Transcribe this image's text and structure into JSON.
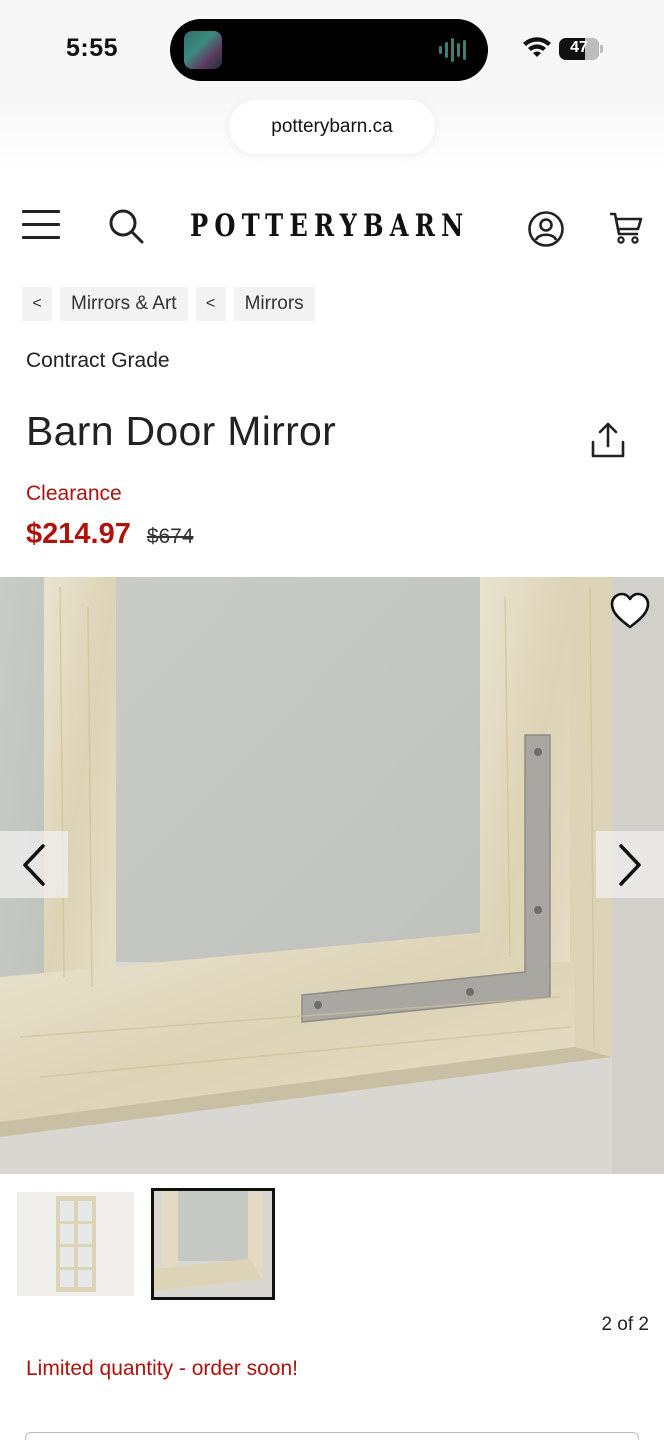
{
  "status_bar": {
    "time": "5:55",
    "battery": "47"
  },
  "browser": {
    "url": "potterybarn.ca"
  },
  "header": {
    "logo": "POTTERYBARN",
    "icons": [
      "menu-icon",
      "search-icon",
      "account-icon",
      "cart-icon"
    ]
  },
  "breadcrumbs": [
    {
      "chevron": "<",
      "label": "Mirrors & Art"
    },
    {
      "chevron": "<",
      "label": "Mirrors"
    }
  ],
  "product": {
    "eyebrow": "Contract Grade",
    "title": "Barn Door Mirror",
    "badge": "Clearance",
    "sale_price": "$214.97",
    "original_price": "$674",
    "availability": "Limited quantity - order soon!"
  },
  "gallery": {
    "counter": "2 of 2",
    "current_index": 2,
    "total": 2
  },
  "colors": {
    "accent_red": "#b0120c",
    "text": "#222222",
    "crumb_bg": "#f3f3f3"
  }
}
